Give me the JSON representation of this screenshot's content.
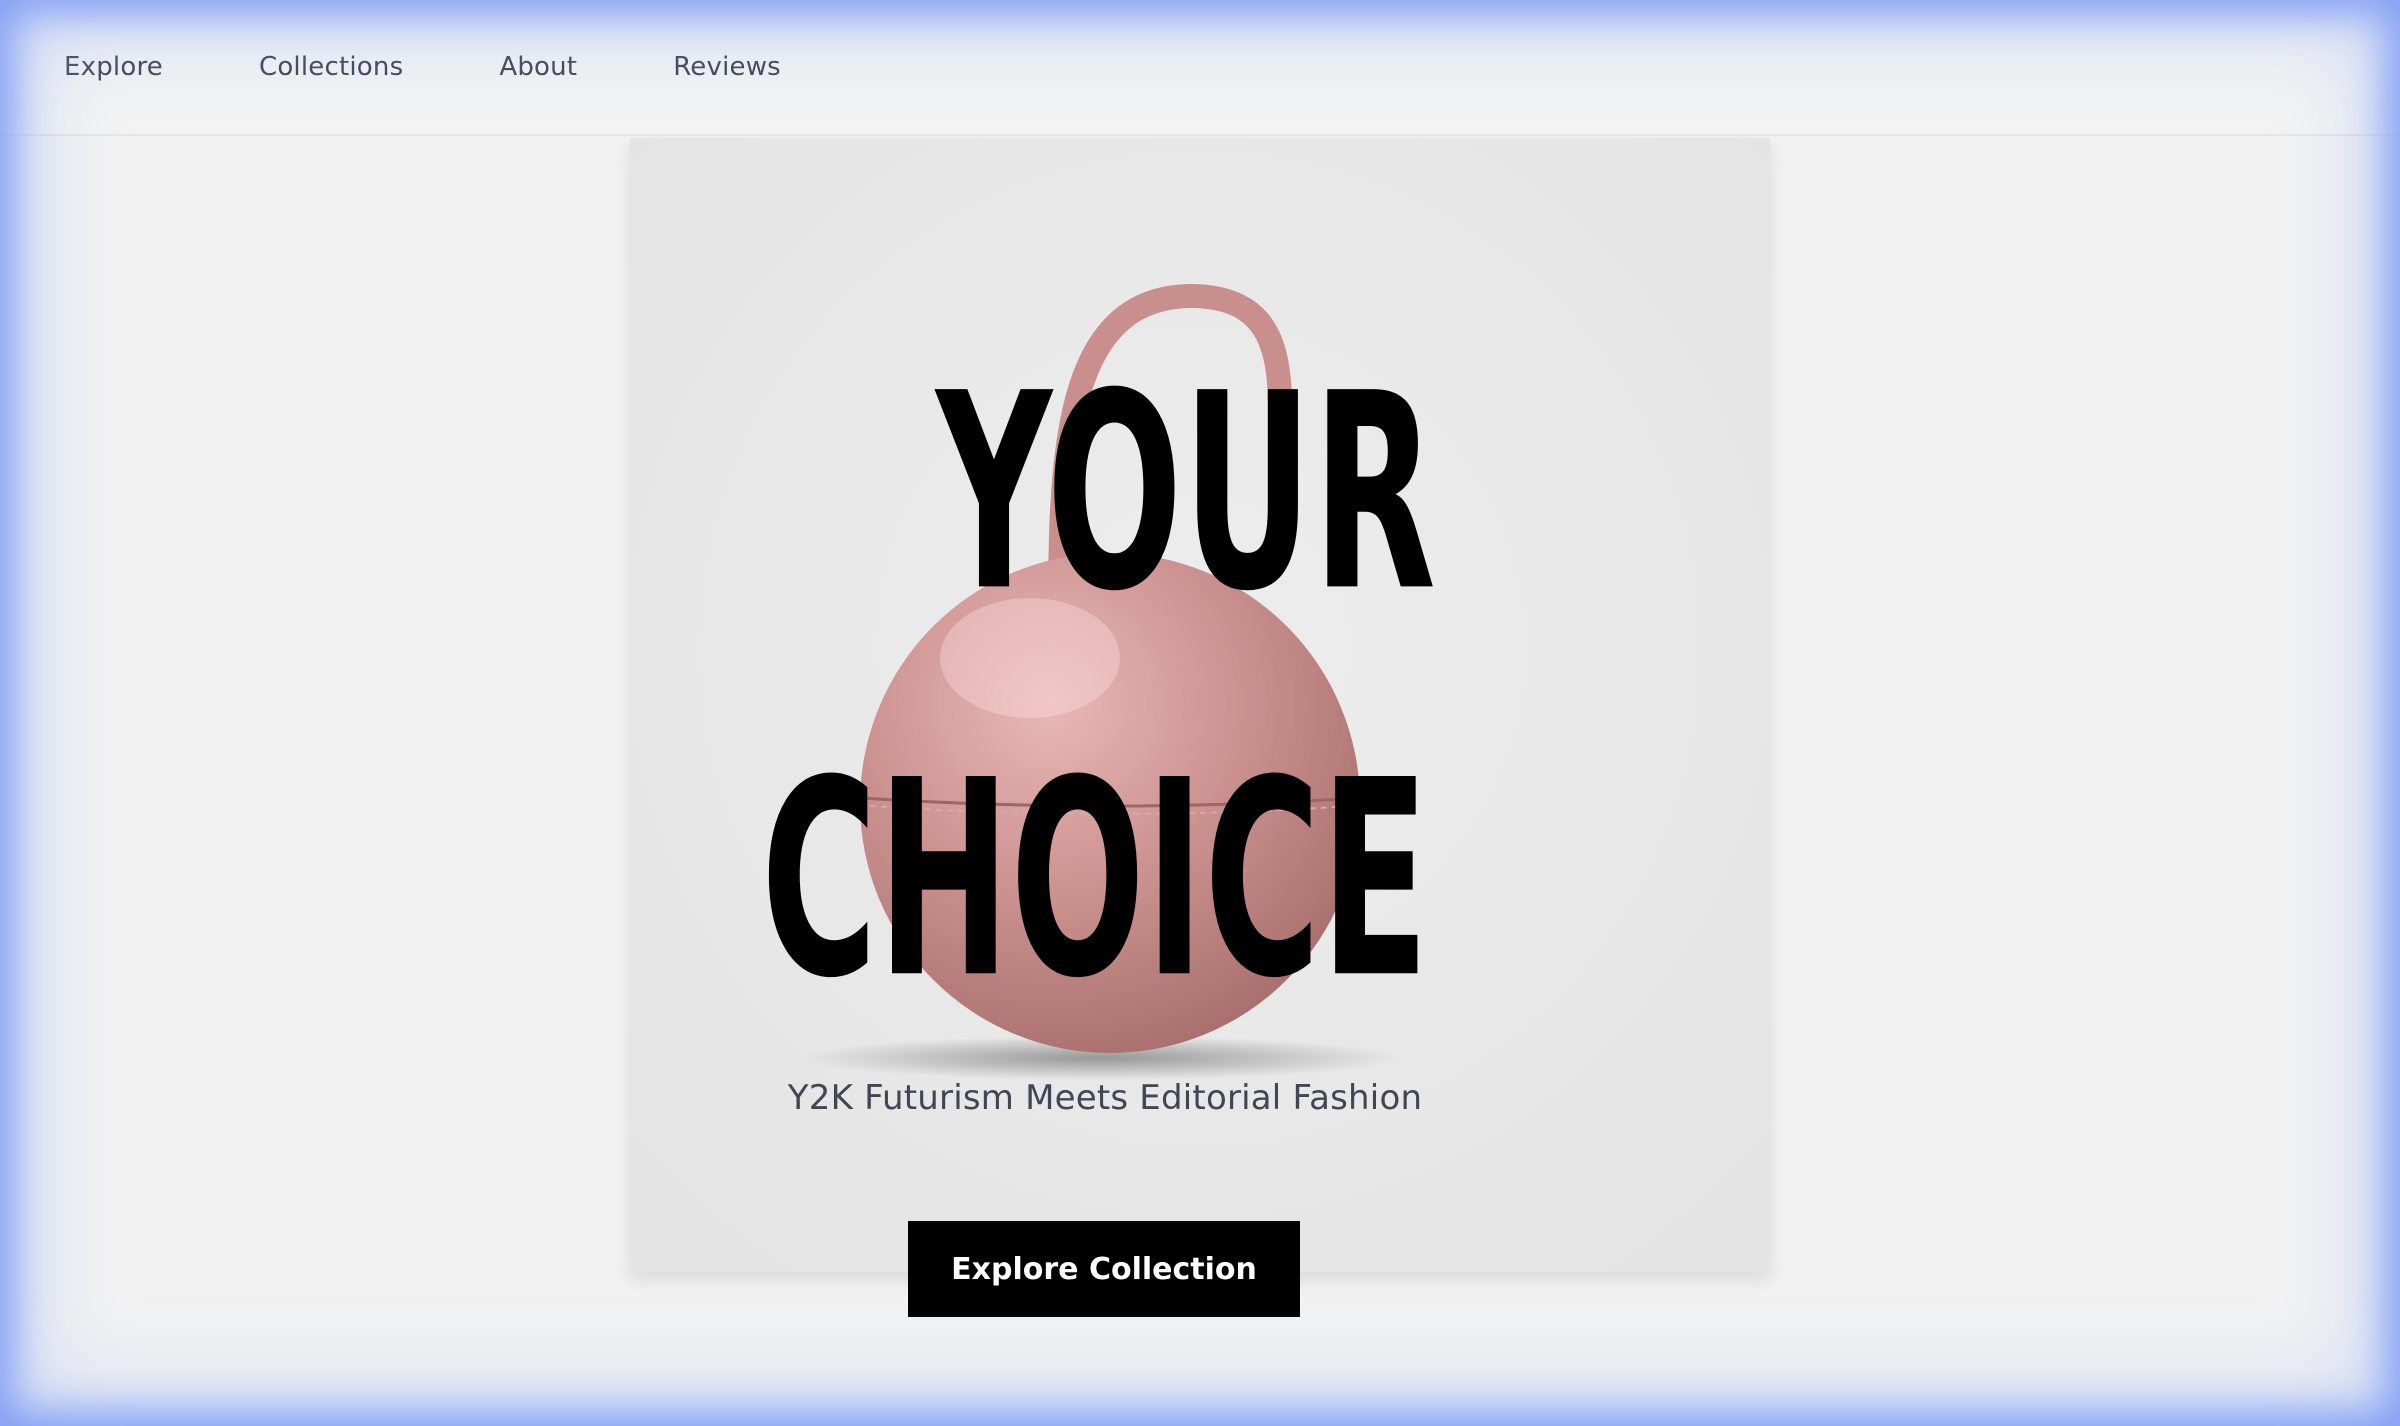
{
  "nav": {
    "items": [
      {
        "label": "Explore"
      },
      {
        "label": "Collections"
      },
      {
        "label": "About"
      },
      {
        "label": "Reviews"
      }
    ]
  },
  "hero": {
    "headline_line1": "YOUR",
    "headline_line2": "CHOICE",
    "subtitle": "Y2K Futurism Meets Editorial Fashion",
    "cta_label": "Explore Collection",
    "product_image": "pink-spherical-handbag",
    "colors": {
      "background": "#f2f2f2",
      "card": "#e9e9e9",
      "bag": "#cf9a98",
      "text": "#000000",
      "subtitle": "#3f4654",
      "glow": "#7896f5"
    }
  }
}
